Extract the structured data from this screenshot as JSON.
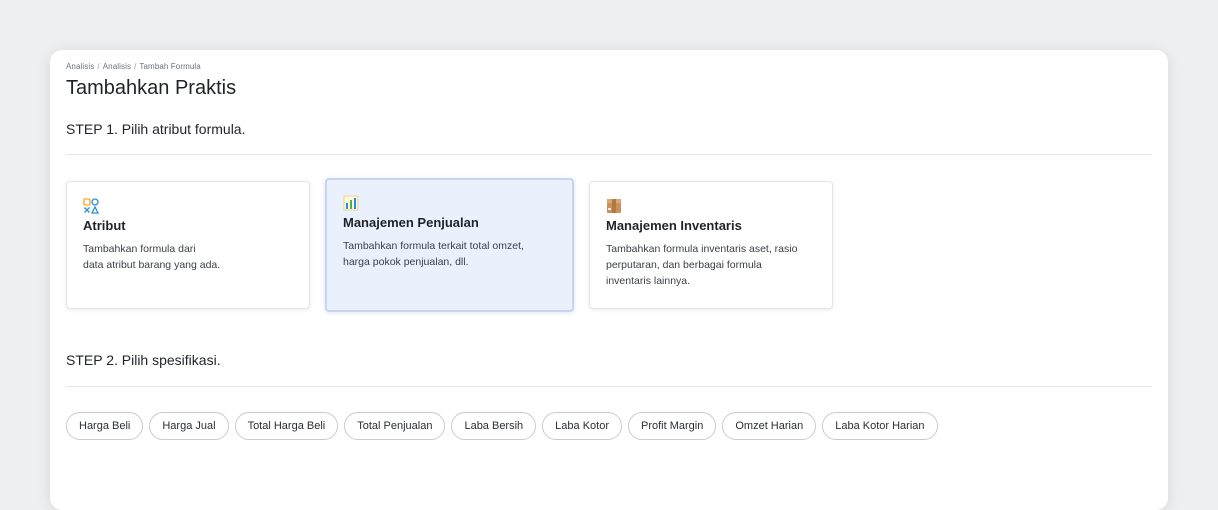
{
  "breadcrumb": [
    "Analisis",
    "Analisis",
    "Tambah Formula"
  ],
  "page_title": "Tambahkan Praktis",
  "step1": {
    "heading": "STEP 1. Pilih atribut formula."
  },
  "cards": [
    {
      "icon": "shapes-icon",
      "title": "Atribut",
      "desc_line1": "Tambahkan formula dari",
      "desc_line2": "data atribut barang yang ada.",
      "desc_line3": ""
    },
    {
      "icon": "bar-chart-icon",
      "title": "Manajemen Penjualan",
      "desc_line1": "Tambahkan formula terkait total omzet,",
      "desc_line2": "harga pokok penjualan, dll.",
      "desc_line3": ""
    },
    {
      "icon": "box-icon",
      "title": "Manajemen Inventaris",
      "desc_line1": "Tambahkan formula inventaris aset, rasio",
      "desc_line2": "perputaran, dan berbagai formula",
      "desc_line3": "inventaris lainnya."
    }
  ],
  "selected_card": "Manajemen Penjualan",
  "step2": {
    "heading": "STEP 2. Pilih spesifikasi."
  },
  "chips": [
    "Harga Beli",
    "Harga Jual",
    "Total Harga Beli",
    "Total Penjualan",
    "Laba Bersih",
    "Laba Kotor",
    "Profit Margin",
    "Omzet Harian",
    "Laba Kotor Harian"
  ],
  "colors": {
    "selected_card_bg": "#ebf1fc",
    "selected_card_border": "#c9d4f2",
    "icon_blue": "#2e8fd8",
    "icon_yellow": "#f5a623",
    "icon_box": "#c8935a"
  }
}
